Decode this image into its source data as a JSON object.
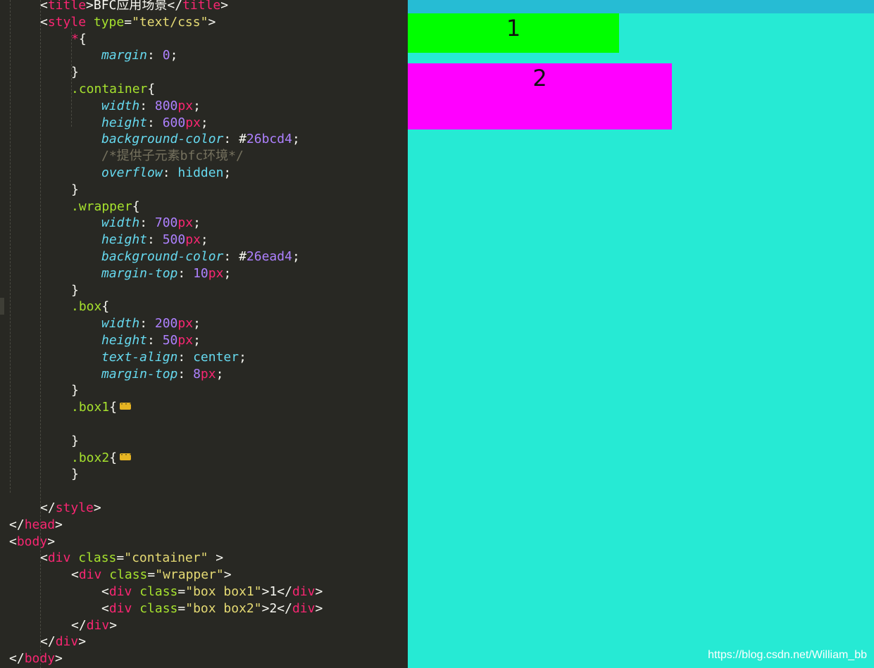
{
  "editor": {
    "lines": [
      {
        "indent": 1,
        "segs": [
          [
            "p",
            "<"
          ],
          [
            "tag",
            "title"
          ],
          [
            "p",
            ">BFC应用场景</"
          ],
          [
            "tag",
            "title"
          ],
          [
            "p",
            ">"
          ]
        ]
      },
      {
        "indent": 1,
        "segs": [
          [
            "p",
            "<"
          ],
          [
            "tag",
            "style"
          ],
          [
            "p",
            " "
          ],
          [
            "attr",
            "type"
          ],
          [
            "p",
            "="
          ],
          [
            "str",
            "\"text/css\""
          ],
          [
            "p",
            ">"
          ]
        ]
      },
      {
        "indent": 2,
        "segs": [
          [
            "tag",
            "*"
          ],
          [
            "p",
            "{"
          ]
        ]
      },
      {
        "indent": 3,
        "segs": [
          [
            "prop",
            "margin"
          ],
          [
            "p",
            ": "
          ],
          [
            "num",
            "0"
          ],
          [
            "p",
            ";"
          ]
        ]
      },
      {
        "indent": 2,
        "segs": [
          [
            "p",
            "}"
          ]
        ]
      },
      {
        "indent": 2,
        "segs": [
          [
            "sel",
            ".container"
          ],
          [
            "p",
            "{"
          ]
        ]
      },
      {
        "indent": 3,
        "segs": [
          [
            "prop",
            "width"
          ],
          [
            "p",
            ": "
          ],
          [
            "num",
            "800"
          ],
          [
            "unit",
            "px"
          ],
          [
            "p",
            ";"
          ]
        ]
      },
      {
        "indent": 3,
        "segs": [
          [
            "prop",
            "height"
          ],
          [
            "p",
            ": "
          ],
          [
            "num",
            "600"
          ],
          [
            "unit",
            "px"
          ],
          [
            "p",
            ";"
          ]
        ]
      },
      {
        "indent": 3,
        "segs": [
          [
            "prop",
            "background-color"
          ],
          [
            "p",
            ": #"
          ],
          [
            "num",
            "26bcd4"
          ],
          [
            "p",
            ";"
          ]
        ]
      },
      {
        "indent": 3,
        "segs": [
          [
            "cmt",
            "/*提供子元素bfc环境*/"
          ]
        ]
      },
      {
        "indent": 3,
        "segs": [
          [
            "prop",
            "overflow"
          ],
          [
            "p",
            ": "
          ],
          [
            "kw",
            "hidden"
          ],
          [
            "p",
            ";"
          ]
        ]
      },
      {
        "indent": 2,
        "segs": [
          [
            "p",
            "}"
          ]
        ]
      },
      {
        "indent": 2,
        "segs": [
          [
            "sel",
            ".wrapper"
          ],
          [
            "p",
            "{"
          ]
        ]
      },
      {
        "indent": 3,
        "segs": [
          [
            "prop",
            "width"
          ],
          [
            "p",
            ": "
          ],
          [
            "num",
            "700"
          ],
          [
            "unit",
            "px"
          ],
          [
            "p",
            ";"
          ]
        ]
      },
      {
        "indent": 3,
        "segs": [
          [
            "prop",
            "height"
          ],
          [
            "p",
            ": "
          ],
          [
            "num",
            "500"
          ],
          [
            "unit",
            "px"
          ],
          [
            "p",
            ";"
          ]
        ]
      },
      {
        "indent": 3,
        "segs": [
          [
            "prop",
            "background-color"
          ],
          [
            "p",
            ": #"
          ],
          [
            "num",
            "26ead4"
          ],
          [
            "p",
            ";"
          ]
        ]
      },
      {
        "indent": 3,
        "segs": [
          [
            "prop",
            "margin-top"
          ],
          [
            "p",
            ": "
          ],
          [
            "num",
            "10"
          ],
          [
            "unit",
            "px"
          ],
          [
            "p",
            ";"
          ]
        ]
      },
      {
        "indent": 2,
        "segs": [
          [
            "p",
            "}"
          ]
        ]
      },
      {
        "indent": 2,
        "segs": [
          [
            "sel",
            ".box"
          ],
          [
            "p",
            "{"
          ]
        ]
      },
      {
        "indent": 3,
        "segs": [
          [
            "prop",
            "width"
          ],
          [
            "p",
            ": "
          ],
          [
            "num",
            "200"
          ],
          [
            "unit",
            "px"
          ],
          [
            "p",
            ";"
          ]
        ]
      },
      {
        "indent": 3,
        "segs": [
          [
            "prop",
            "height"
          ],
          [
            "p",
            ": "
          ],
          [
            "num",
            "50"
          ],
          [
            "unit",
            "px"
          ],
          [
            "p",
            ";"
          ]
        ]
      },
      {
        "indent": 3,
        "segs": [
          [
            "prop",
            "text-align"
          ],
          [
            "p",
            ": "
          ],
          [
            "kw",
            "center"
          ],
          [
            "p",
            ";"
          ]
        ]
      },
      {
        "indent": 3,
        "segs": [
          [
            "prop",
            "margin-top"
          ],
          [
            "p",
            ": "
          ],
          [
            "num",
            "8"
          ],
          [
            "unit",
            "px"
          ],
          [
            "p",
            ";"
          ]
        ]
      },
      {
        "indent": 2,
        "segs": [
          [
            "p",
            "}"
          ]
        ]
      },
      {
        "indent": 2,
        "segs": [
          [
            "sel",
            ".box1"
          ],
          [
            "p",
            "{"
          ]
        ],
        "fold": true
      },
      {
        "indent": 2,
        "segs": []
      },
      {
        "indent": 2,
        "segs": [
          [
            "p",
            "}"
          ]
        ]
      },
      {
        "indent": 2,
        "segs": [
          [
            "sel",
            ".box2"
          ],
          [
            "p",
            "{"
          ]
        ],
        "fold": true
      },
      {
        "indent": 2,
        "segs": [
          [
            "p",
            "}"
          ]
        ]
      },
      {
        "indent": 0,
        "segs": []
      },
      {
        "indent": 1,
        "segs": [
          [
            "p",
            "</"
          ],
          [
            "tag",
            "style"
          ],
          [
            "p",
            ">"
          ]
        ]
      },
      {
        "indent": 0,
        "segs": [
          [
            "p",
            "</"
          ],
          [
            "tag",
            "head"
          ],
          [
            "p",
            ">"
          ]
        ]
      },
      {
        "indent": 0,
        "segs": [
          [
            "p",
            "<"
          ],
          [
            "tag",
            "body"
          ],
          [
            "p",
            ">"
          ]
        ]
      },
      {
        "indent": 1,
        "segs": [
          [
            "p",
            "<"
          ],
          [
            "tag",
            "div"
          ],
          [
            "p",
            " "
          ],
          [
            "attr",
            "class"
          ],
          [
            "p",
            "="
          ],
          [
            "str",
            "\"container\""
          ],
          [
            "p",
            " >"
          ]
        ]
      },
      {
        "indent": 2,
        "segs": [
          [
            "p",
            "<"
          ],
          [
            "tag",
            "div"
          ],
          [
            "p",
            " "
          ],
          [
            "attr",
            "class"
          ],
          [
            "p",
            "="
          ],
          [
            "str",
            "\"wrapper\""
          ],
          [
            "p",
            ">"
          ]
        ]
      },
      {
        "indent": 3,
        "segs": [
          [
            "p",
            "<"
          ],
          [
            "tag",
            "div"
          ],
          [
            "p",
            " "
          ],
          [
            "attr",
            "class"
          ],
          [
            "p",
            "="
          ],
          [
            "str",
            "\"box box1\""
          ],
          [
            "p",
            ">1</"
          ],
          [
            "tag",
            "div"
          ],
          [
            "p",
            ">"
          ]
        ]
      },
      {
        "indent": 3,
        "segs": [
          [
            "p",
            "<"
          ],
          [
            "tag",
            "div"
          ],
          [
            "p",
            " "
          ],
          [
            "attr",
            "class"
          ],
          [
            "p",
            "="
          ],
          [
            "str",
            "\"box box2\""
          ],
          [
            "p",
            ">2</"
          ],
          [
            "tag",
            "div"
          ],
          [
            "p",
            ">"
          ]
        ]
      },
      {
        "indent": 2,
        "segs": [
          [
            "p",
            "</"
          ],
          [
            "tag",
            "div"
          ],
          [
            "p",
            ">"
          ]
        ]
      },
      {
        "indent": 1,
        "segs": [
          [
            "p",
            "</"
          ],
          [
            "tag",
            "div"
          ],
          [
            "p",
            ">"
          ]
        ]
      },
      {
        "indent": 0,
        "segs": [
          [
            "p",
            "</"
          ],
          [
            "tag",
            "body"
          ],
          [
            "p",
            ">"
          ]
        ]
      }
    ]
  },
  "preview": {
    "container_color": "#26bcd4",
    "wrapper_color": "#26ead4",
    "box1": {
      "text": "1",
      "color": "#00ff00"
    },
    "box2": {
      "text": "2",
      "color": "#ff00ff"
    },
    "watermark": "https://blog.csdn.net/William_bb"
  }
}
